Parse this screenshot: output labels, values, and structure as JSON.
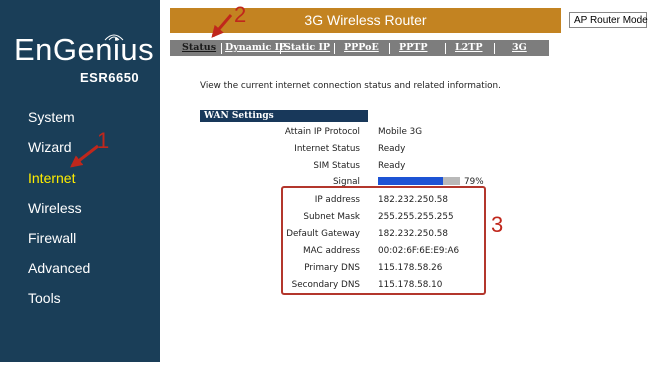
{
  "brand": {
    "logo": "EnGenius",
    "model": "ESR6650"
  },
  "header": {
    "title": "3G Wireless Router",
    "mode": "AP Router Mode"
  },
  "sidebar": {
    "items": [
      {
        "label": "System"
      },
      {
        "label": "Wizard"
      },
      {
        "label": "Internet"
      },
      {
        "label": "Wireless"
      },
      {
        "label": "Firewall"
      },
      {
        "label": "Advanced"
      },
      {
        "label": "Tools"
      }
    ],
    "active": "Internet"
  },
  "tabs": [
    {
      "label": "Status"
    },
    {
      "label": "Dynamic IP"
    },
    {
      "label": "Static IP"
    },
    {
      "label": "PPPoE"
    },
    {
      "label": "PPTP"
    },
    {
      "label": "L2TP"
    },
    {
      "label": "3G"
    }
  ],
  "active_tab": "Status",
  "intro": "View the current internet connection status and related information.",
  "wan": {
    "heading": "WAN Settings",
    "rows": [
      {
        "label": "Attain IP Protocol",
        "value": "Mobile 3G"
      },
      {
        "label": "Internet Status",
        "value": "Ready"
      },
      {
        "label": "SIM Status",
        "value": "Ready"
      },
      {
        "label": "Signal",
        "value": ""
      },
      {
        "label": "IP address",
        "value": "182.232.250.58"
      },
      {
        "label": "Subnet Mask",
        "value": "255.255.255.255"
      },
      {
        "label": "Default Gateway",
        "value": "182.232.250.58"
      },
      {
        "label": "MAC address",
        "value": "00:02:6F:6E:E9:A6"
      },
      {
        "label": "Primary DNS",
        "value": "115.178.58.26"
      },
      {
        "label": "Secondary DNS",
        "value": "115.178.58.10"
      }
    ],
    "signal_percent": 79,
    "signal_text": "79%"
  },
  "annotations": {
    "one": "1",
    "two": "2",
    "three": "3"
  },
  "colors": {
    "sidebar": "#1a3e58",
    "header": "#c38321",
    "tab_bar": "#7d7d7d",
    "active_menu": "#ffee00",
    "annotation": "#c0271c",
    "signal": "#1d53d4"
  }
}
